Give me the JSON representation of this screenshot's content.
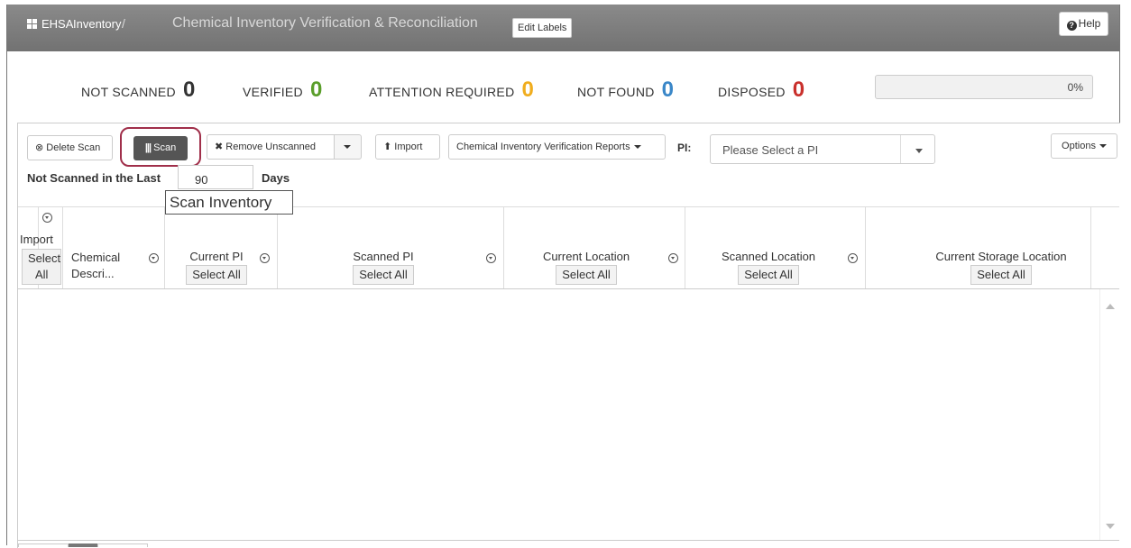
{
  "header": {
    "brand": "EHSA",
    "crumb_inventory": "Inventory",
    "separator": "/",
    "page_title": "Chemical Inventory Verification & Reconciliation",
    "edit_labels": "Edit Labels",
    "help": "Help"
  },
  "stats": {
    "not_scanned": {
      "label": "NOT SCANNED",
      "value": "0",
      "color": "#333333"
    },
    "verified": {
      "label": "VERIFIED",
      "value": "0",
      "color": "#5a9e2a"
    },
    "attention": {
      "label": "ATTENTION REQUIRED",
      "value": "0",
      "color": "#f0ad1e"
    },
    "not_found": {
      "label": "NOT FOUND",
      "value": "0",
      "color": "#3a87c8"
    },
    "disposed": {
      "label": "DISPOSED",
      "value": "0",
      "color": "#c9302c"
    },
    "progress_percent": 0,
    "progress_text": "0%"
  },
  "toolbar": {
    "delete_scan": "Delete Scan",
    "scan": "Scan",
    "remove_unscanned": "Remove Unscanned",
    "import": "Import",
    "reports": "Chemical Inventory Verification Reports",
    "pi_label": "PI:",
    "pi_placeholder": "Please Select a PI",
    "options": "Options",
    "not_scanned_label": "Not Scanned in the Last",
    "days_value": "90",
    "days_suffix": "Days",
    "tooltip": "Scan Inventory"
  },
  "grid": {
    "col_import": "Import",
    "col_import_select": "Select",
    "col_import_all": "All",
    "col_chemical_1": "Chemical",
    "col_chemical_2": "Descri...",
    "columns": [
      {
        "title": "Current PI",
        "button": "Select All"
      },
      {
        "title": "Scanned PI",
        "button": "Select All"
      },
      {
        "title": "Current Location",
        "button": "Select All"
      },
      {
        "title": "Scanned Location",
        "button": "Select All"
      },
      {
        "title": "Current Storage Location",
        "button": "Select All"
      }
    ]
  }
}
